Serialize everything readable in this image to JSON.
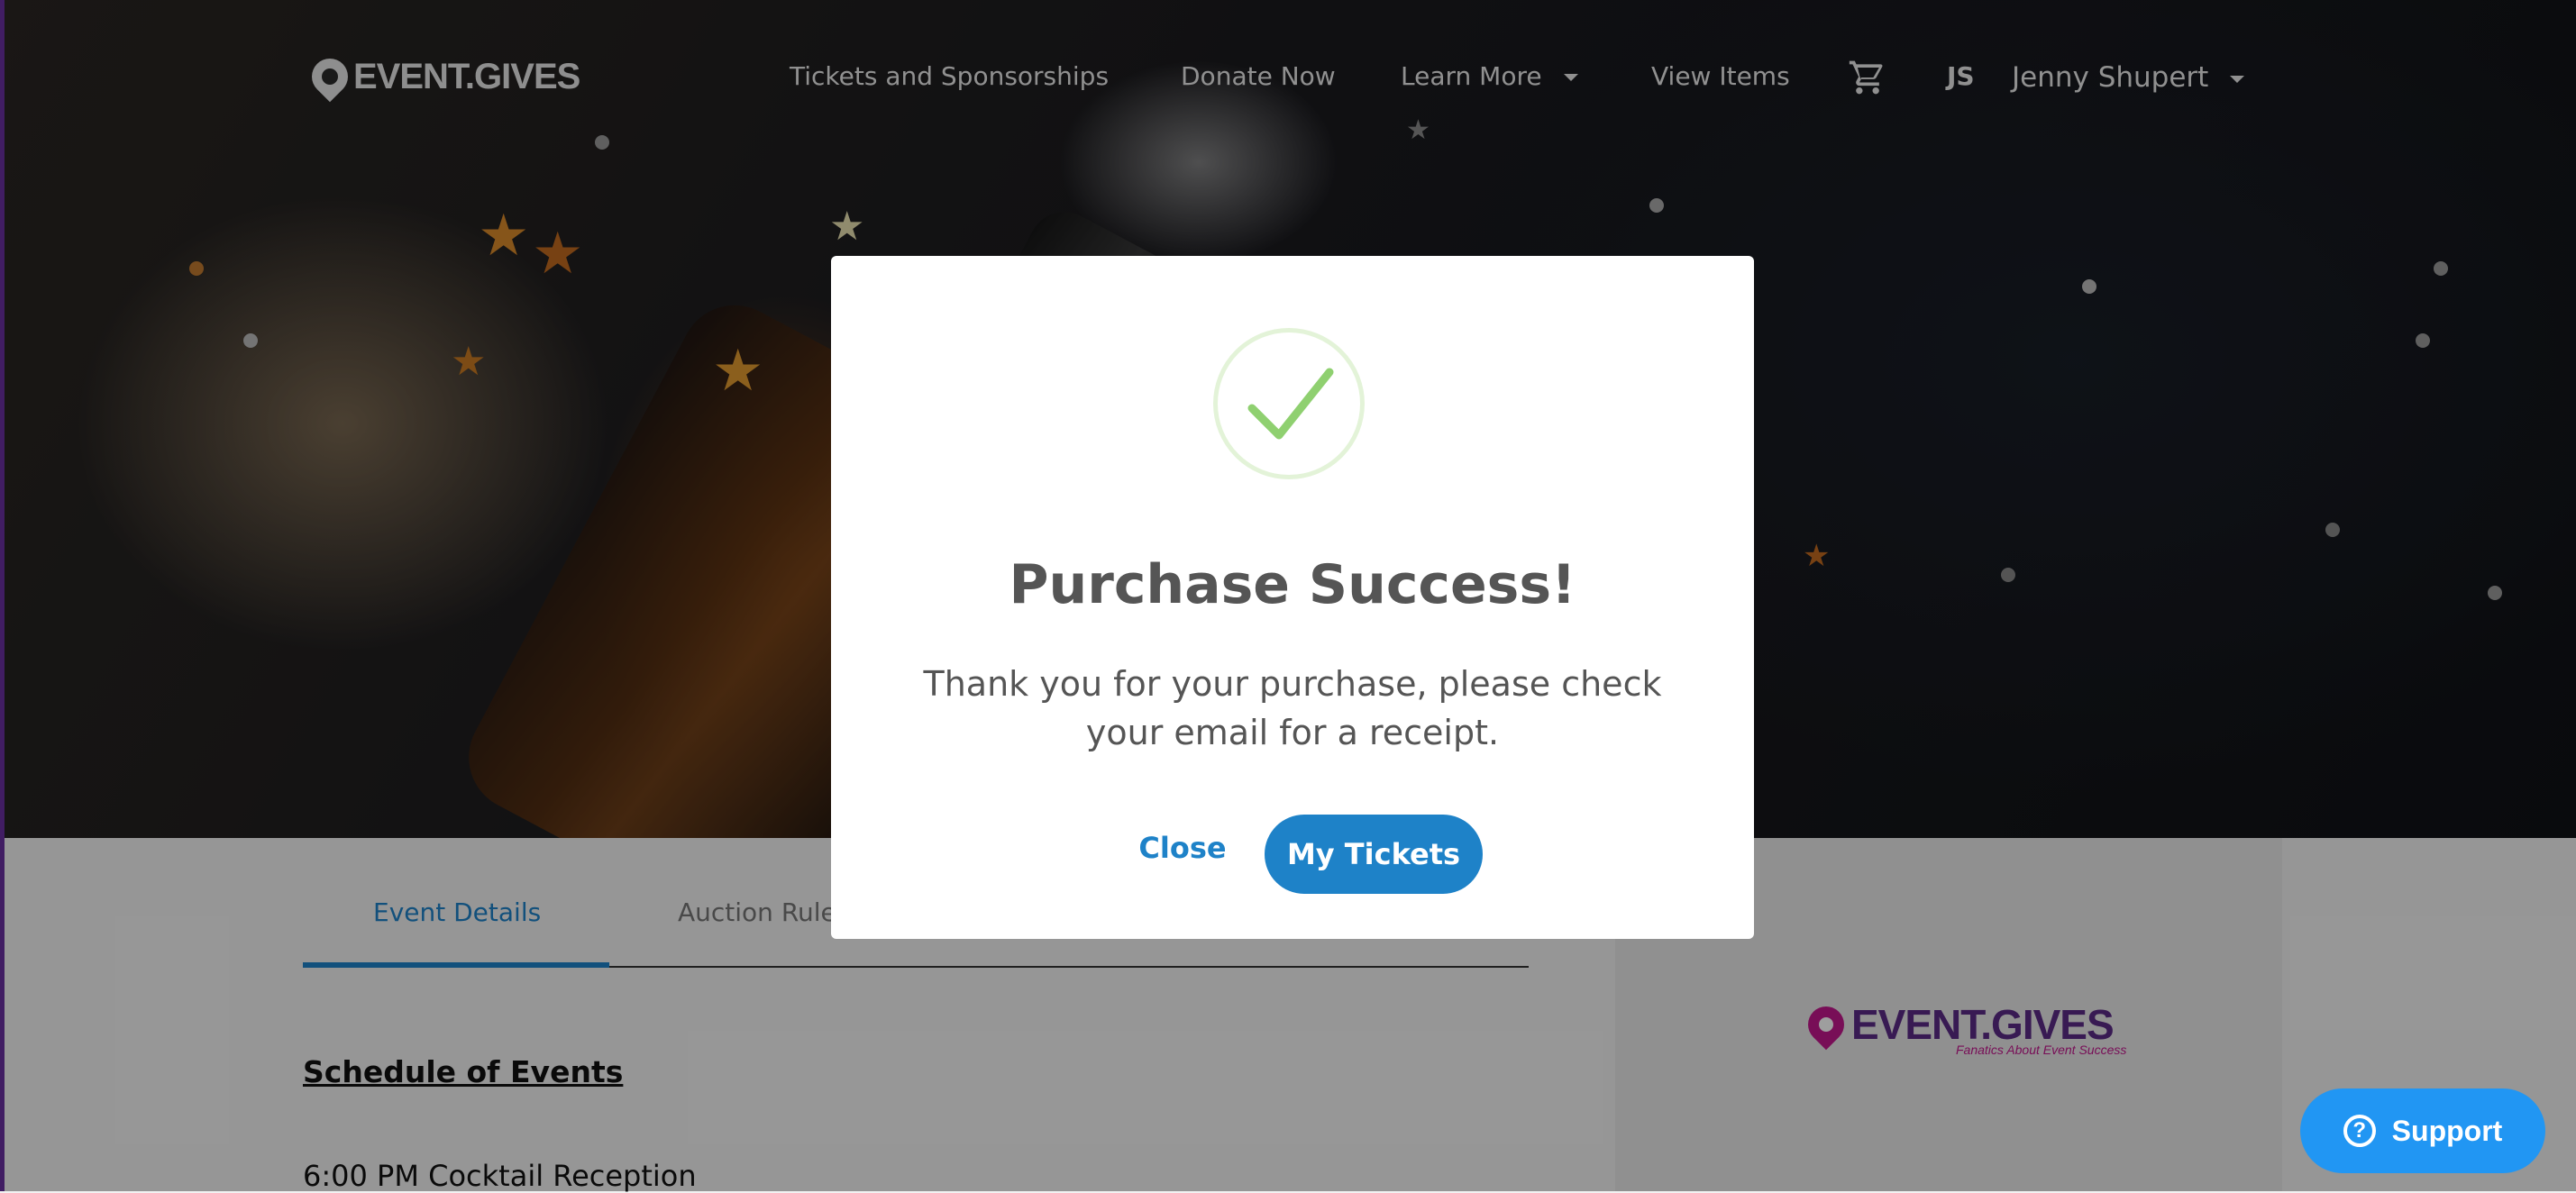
{
  "nav": {
    "logo_text": "EVENT.GIVES",
    "items": [
      {
        "label": "Tickets and Sponsorships"
      },
      {
        "label": "Donate Now"
      },
      {
        "label": "Learn More"
      },
      {
        "label": "View Items"
      }
    ],
    "cart_icon": "shopping-cart-icon",
    "user_initials": "JS",
    "user_name": "Jenny Shupert"
  },
  "tabs": [
    {
      "label": "Event Details",
      "active": true
    },
    {
      "label": "Auction Rules",
      "active": false
    }
  ],
  "content": {
    "schedule_title": "Schedule of Events",
    "schedule_items": [
      "6:00 PM Cocktail Reception"
    ]
  },
  "sidebar": {
    "logo_text": "EVENT.GIVES",
    "tagline": "Fanatics About Event Success"
  },
  "modal": {
    "icon": "checkmark-icon",
    "title": "Purchase Success!",
    "message": "Thank you for your purchase, please check your email for a receipt.",
    "close_label": "Close",
    "primary_label": "My Tickets"
  },
  "support": {
    "label": "Support",
    "icon": "question-circle-icon"
  },
  "colors": {
    "accent": "#1e82c8",
    "success_check": "#8fd070",
    "brand_purple": "#5b2a86",
    "brand_pink": "#c2188d",
    "support_blue": "#2196f3"
  }
}
